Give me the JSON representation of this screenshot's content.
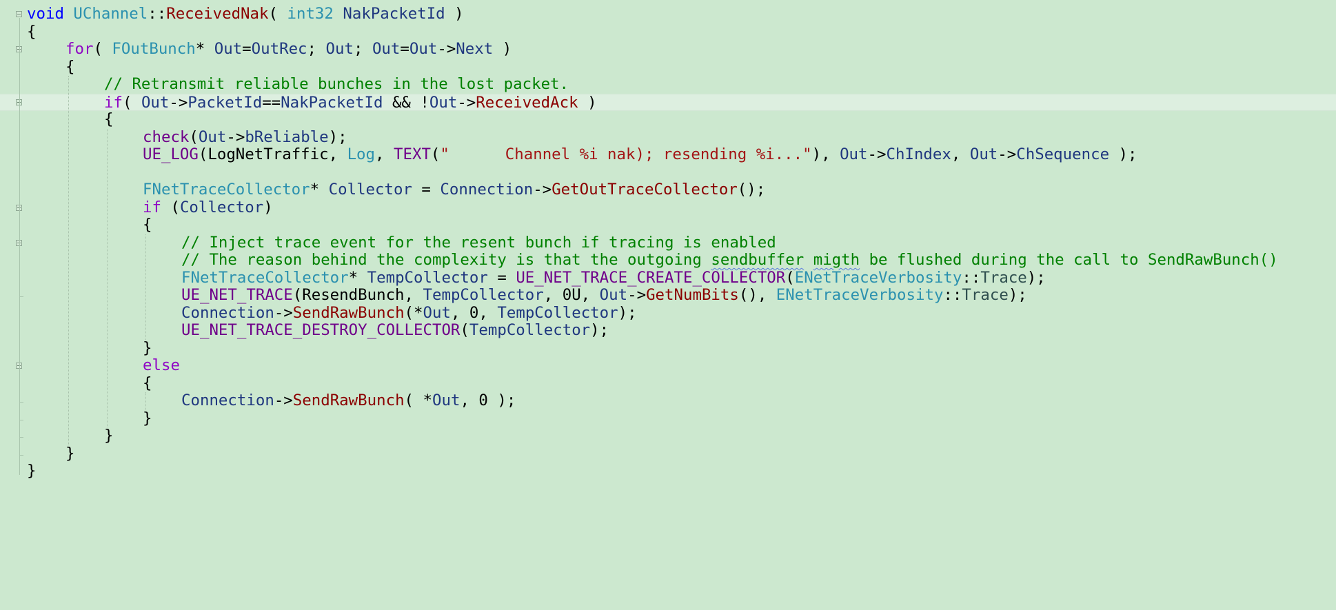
{
  "editor": {
    "background": "#cce8cf",
    "current_line_index": 5,
    "lines": [
      {
        "indent": 0,
        "tokens": [
          {
            "c": "kw",
            "t": "void"
          },
          {
            "c": "plain",
            "t": " "
          },
          {
            "c": "type",
            "t": "UChannel"
          },
          {
            "c": "plain",
            "t": "::"
          },
          {
            "c": "fnr",
            "t": "ReceivedNak"
          },
          {
            "c": "plain",
            "t": "( "
          },
          {
            "c": "type",
            "t": "int32"
          },
          {
            "c": "plain",
            "t": " "
          },
          {
            "c": "var",
            "t": "NakPacketId"
          },
          {
            "c": "plain",
            "t": " )"
          }
        ]
      },
      {
        "indent": 0,
        "tokens": [
          {
            "c": "plain",
            "t": "{"
          }
        ]
      },
      {
        "indent": 1,
        "tokens": [
          {
            "c": "kw2",
            "t": "for"
          },
          {
            "c": "plain",
            "t": "( "
          },
          {
            "c": "type",
            "t": "FOutBunch"
          },
          {
            "c": "plain",
            "t": "* "
          },
          {
            "c": "var",
            "t": "Out"
          },
          {
            "c": "plain",
            "t": "="
          },
          {
            "c": "member",
            "t": "OutRec"
          },
          {
            "c": "plain",
            "t": "; "
          },
          {
            "c": "var",
            "t": "Out"
          },
          {
            "c": "plain",
            "t": "; "
          },
          {
            "c": "var",
            "t": "Out"
          },
          {
            "c": "plain",
            "t": "="
          },
          {
            "c": "var",
            "t": "Out"
          },
          {
            "c": "plain",
            "t": "->"
          },
          {
            "c": "member",
            "t": "Next"
          },
          {
            "c": "plain",
            "t": " )"
          }
        ]
      },
      {
        "indent": 1,
        "tokens": [
          {
            "c": "plain",
            "t": "{"
          }
        ]
      },
      {
        "indent": 2,
        "tokens": [
          {
            "c": "com",
            "t": "// Retransmit reliable bunches in the lost packet."
          }
        ]
      },
      {
        "indent": 2,
        "tokens": [
          {
            "c": "kw2",
            "t": "if"
          },
          {
            "c": "plain",
            "t": "( "
          },
          {
            "c": "var",
            "t": "Out"
          },
          {
            "c": "plain",
            "t": "->"
          },
          {
            "c": "member",
            "t": "PacketId"
          },
          {
            "c": "plain",
            "t": "=="
          },
          {
            "c": "var",
            "t": "NakPacketId"
          },
          {
            "c": "plain",
            "t": " && !"
          },
          {
            "c": "var",
            "t": "Out"
          },
          {
            "c": "plain",
            "t": "->"
          },
          {
            "c": "fnr",
            "t": "ReceivedAck"
          },
          {
            "c": "plain",
            "t": " )"
          }
        ]
      },
      {
        "indent": 2,
        "tokens": [
          {
            "c": "plain",
            "t": "{"
          }
        ]
      },
      {
        "indent": 3,
        "tokens": [
          {
            "c": "macro",
            "t": "check"
          },
          {
            "c": "plain",
            "t": "("
          },
          {
            "c": "var",
            "t": "Out"
          },
          {
            "c": "plain",
            "t": "->"
          },
          {
            "c": "member",
            "t": "bReliable"
          },
          {
            "c": "plain",
            "t": ");"
          }
        ]
      },
      {
        "indent": 3,
        "tokens": [
          {
            "c": "macro",
            "t": "UE_LOG"
          },
          {
            "c": "plain",
            "t": "(LogNetTraffic, "
          },
          {
            "c": "type",
            "t": "Log"
          },
          {
            "c": "plain",
            "t": ", "
          },
          {
            "c": "macro",
            "t": "TEXT"
          },
          {
            "c": "plain",
            "t": "("
          },
          {
            "c": "str",
            "t": "\"      Channel %i nak); resending %i...\""
          },
          {
            "c": "plain",
            "t": "), "
          },
          {
            "c": "var",
            "t": "Out"
          },
          {
            "c": "plain",
            "t": "->"
          },
          {
            "c": "member",
            "t": "ChIndex"
          },
          {
            "c": "plain",
            "t": ", "
          },
          {
            "c": "var",
            "t": "Out"
          },
          {
            "c": "plain",
            "t": "->"
          },
          {
            "c": "member",
            "t": "ChSequence"
          },
          {
            "c": "plain",
            "t": " );"
          }
        ]
      },
      {
        "indent": 3,
        "tokens": []
      },
      {
        "indent": 3,
        "tokens": [
          {
            "c": "type",
            "t": "FNetTraceCollector"
          },
          {
            "c": "plain",
            "t": "* "
          },
          {
            "c": "var",
            "t": "Collector"
          },
          {
            "c": "plain",
            "t": " = "
          },
          {
            "c": "var",
            "t": "Connection"
          },
          {
            "c": "plain",
            "t": "->"
          },
          {
            "c": "fnr",
            "t": "GetOutTraceCollector"
          },
          {
            "c": "plain",
            "t": "();"
          }
        ]
      },
      {
        "indent": 3,
        "tokens": [
          {
            "c": "kw2",
            "t": "if"
          },
          {
            "c": "plain",
            "t": " ("
          },
          {
            "c": "var",
            "t": "Collector"
          },
          {
            "c": "plain",
            "t": ")"
          }
        ]
      },
      {
        "indent": 3,
        "tokens": [
          {
            "c": "plain",
            "t": "{"
          }
        ]
      },
      {
        "indent": 4,
        "tokens": [
          {
            "c": "com",
            "t": "// Inject trace event for the resent bunch if tracing is enabled"
          }
        ]
      },
      {
        "indent": 4,
        "tokens": [
          {
            "c": "com",
            "t": "// The reason behind the complexity is that the outgoing "
          },
          {
            "c": "com squig",
            "t": "sendbuffer"
          },
          {
            "c": "com",
            "t": " "
          },
          {
            "c": "com squig",
            "t": "migth"
          },
          {
            "c": "com",
            "t": " be flushed during the call to SendRawBunch()"
          }
        ]
      },
      {
        "indent": 4,
        "tokens": [
          {
            "c": "type",
            "t": "FNetTraceCollector"
          },
          {
            "c": "plain",
            "t": "* "
          },
          {
            "c": "var",
            "t": "TempCollector"
          },
          {
            "c": "plain",
            "t": " = "
          },
          {
            "c": "macro",
            "t": "UE_NET_TRACE_CREATE_COLLECTOR"
          },
          {
            "c": "plain",
            "t": "("
          },
          {
            "c": "type",
            "t": "ENetTraceVerbosity"
          },
          {
            "c": "plain",
            "t": "::"
          },
          {
            "c": "enum",
            "t": "Trace"
          },
          {
            "c": "plain",
            "t": ");"
          }
        ]
      },
      {
        "indent": 4,
        "tokens": [
          {
            "c": "macro",
            "t": "UE_NET_TRACE"
          },
          {
            "c": "plain",
            "t": "(ResendBunch, "
          },
          {
            "c": "var",
            "t": "TempCollector"
          },
          {
            "c": "plain",
            "t": ", 0U, "
          },
          {
            "c": "var",
            "t": "Out"
          },
          {
            "c": "plain",
            "t": "->"
          },
          {
            "c": "fnr",
            "t": "GetNumBits"
          },
          {
            "c": "plain",
            "t": "(), "
          },
          {
            "c": "type",
            "t": "ENetTraceVerbosity"
          },
          {
            "c": "plain",
            "t": "::"
          },
          {
            "c": "enum",
            "t": "Trace"
          },
          {
            "c": "plain",
            "t": ");"
          }
        ]
      },
      {
        "indent": 4,
        "tokens": [
          {
            "c": "var",
            "t": "Connection"
          },
          {
            "c": "plain",
            "t": "->"
          },
          {
            "c": "fnr",
            "t": "SendRawBunch"
          },
          {
            "c": "plain",
            "t": "(*"
          },
          {
            "c": "var",
            "t": "Out"
          },
          {
            "c": "plain",
            "t": ", 0, "
          },
          {
            "c": "var",
            "t": "TempCollector"
          },
          {
            "c": "plain",
            "t": ");"
          }
        ]
      },
      {
        "indent": 4,
        "tokens": [
          {
            "c": "macro",
            "t": "UE_NET_TRACE_DESTROY_COLLECTOR"
          },
          {
            "c": "plain",
            "t": "("
          },
          {
            "c": "var",
            "t": "TempCollector"
          },
          {
            "c": "plain",
            "t": ");"
          }
        ]
      },
      {
        "indent": 3,
        "tokens": [
          {
            "c": "plain",
            "t": "}"
          }
        ]
      },
      {
        "indent": 3,
        "tokens": [
          {
            "c": "kw2",
            "t": "else"
          }
        ]
      },
      {
        "indent": 3,
        "tokens": [
          {
            "c": "plain",
            "t": "{"
          }
        ]
      },
      {
        "indent": 4,
        "tokens": [
          {
            "c": "var",
            "t": "Connection"
          },
          {
            "c": "plain",
            "t": "->"
          },
          {
            "c": "fnr",
            "t": "SendRawBunch"
          },
          {
            "c": "plain",
            "t": "( *"
          },
          {
            "c": "var",
            "t": "Out"
          },
          {
            "c": "plain",
            "t": ", 0 );"
          }
        ]
      },
      {
        "indent": 3,
        "tokens": [
          {
            "c": "plain",
            "t": "}"
          }
        ]
      },
      {
        "indent": 2,
        "tokens": [
          {
            "c": "plain",
            "t": "}"
          }
        ]
      },
      {
        "indent": 1,
        "tokens": [
          {
            "c": "plain",
            "t": "}"
          }
        ]
      },
      {
        "indent": 0,
        "tokens": [
          {
            "c": "plain",
            "t": "}"
          }
        ]
      }
    ]
  }
}
